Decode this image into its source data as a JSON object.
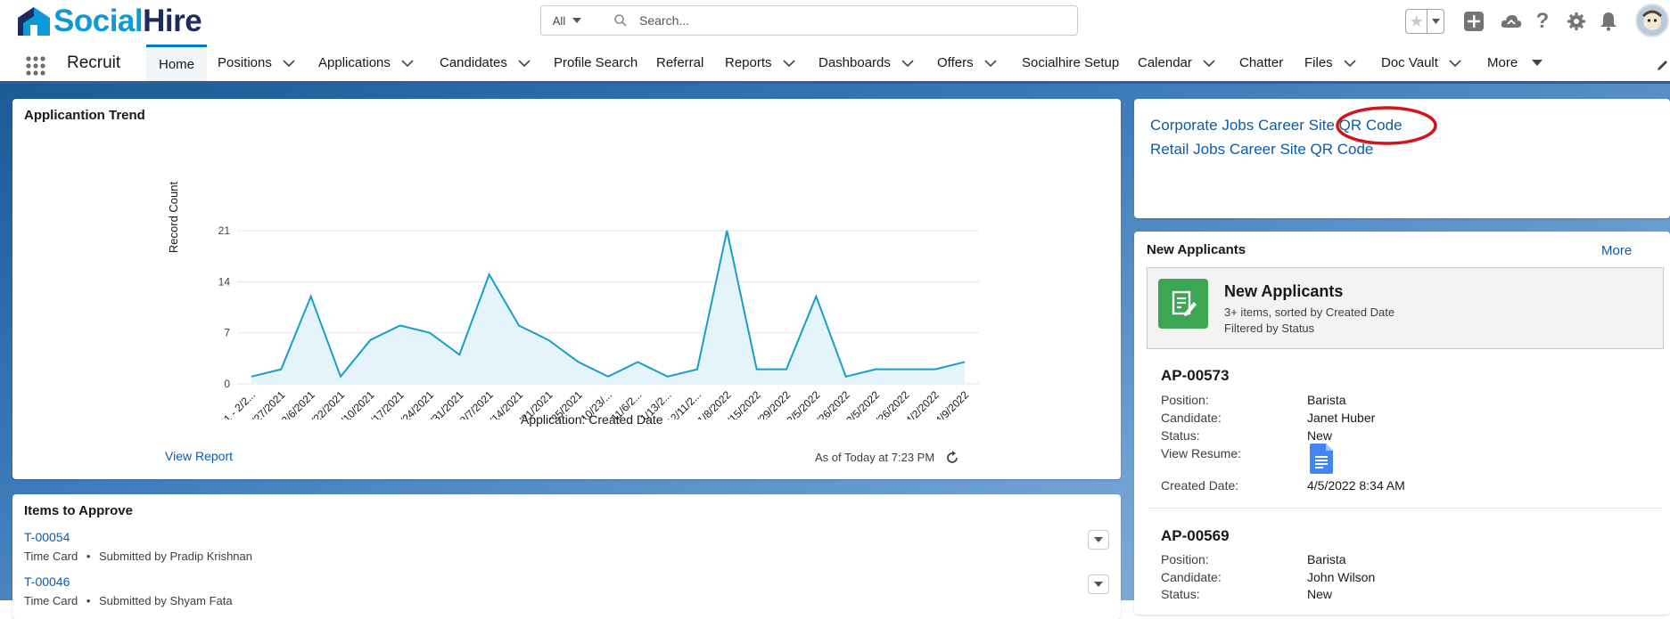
{
  "header": {
    "logo_text_1": "Social",
    "logo_text_2": "Hire",
    "search_scope": "All",
    "search_placeholder": "Search..."
  },
  "nav": {
    "app_name": "Recruit",
    "items": [
      {
        "label": "Home",
        "has_menu": false
      },
      {
        "label": "Positions",
        "has_menu": true
      },
      {
        "label": "Applications",
        "has_menu": true
      },
      {
        "label": "Candidates",
        "has_menu": true
      },
      {
        "label": "Profile Search",
        "has_menu": false
      },
      {
        "label": "Referral",
        "has_menu": false
      },
      {
        "label": "Reports",
        "has_menu": true
      },
      {
        "label": "Dashboards",
        "has_menu": true
      },
      {
        "label": "Offers",
        "has_menu": true
      },
      {
        "label": "Socialhire Setup",
        "has_menu": false
      },
      {
        "label": "Calendar",
        "has_menu": true
      },
      {
        "label": "Chatter",
        "has_menu": false
      },
      {
        "label": "Files",
        "has_menu": true
      },
      {
        "label": "Doc Vault",
        "has_menu": true
      },
      {
        "label": "More",
        "has_menu": true
      }
    ]
  },
  "trend_card": {
    "title": "Applicantion Trend",
    "view_report": "View Report",
    "as_of": "As of Today at 7:23 PM"
  },
  "chart_data": {
    "type": "area",
    "title": "",
    "xlabel": "Application: Created Date",
    "ylabel": "Record Count",
    "ylim": [
      0,
      21
    ],
    "yticks": [
      0,
      7,
      14,
      21
    ],
    "grid": true,
    "categories": [
      "2/14/2021 - 2/2...",
      "2/21/2021 - 2/27/2021",
      "2/28/2021 - 3/6/2021",
      "5/16/2021 - 5/22/2021",
      "7/4/2021 - 7/10/2021",
      "7/11/2021 - 7/17/2021",
      "7/18/2021 - 7/24/2021",
      "7/25/2021 - 7/31/2021",
      "8/1/2021 - 8/7/2021",
      "8/8/2021 - 8/14/2021",
      "8/15/2021 - 8/21/2021",
      "9/19/2021 - 9/25/2021",
      "10/17/2021 - 10/23/...",
      "10/31/2021 - 11/6/2...",
      "11/7/2021 - 11/13/2...",
      "12/5/2021 - 12/11/2...",
      "1/2/2022 - 1/8/2022",
      "1/9/2022 - 1/15/2022",
      "1/23/2022 - 1/29/2022",
      "1/30/2022 - 2/5/2022",
      "2/20/2022 - 2/26/2022",
      "2/27/2022 - 3/5/2022",
      "3/20/2022 - 3/26/2022",
      "3/27/2022 - 4/2/2022",
      "4/3/2022 - 4/9/2022"
    ],
    "values": [
      1,
      2,
      12,
      1,
      6,
      8,
      7,
      4,
      15,
      8,
      6,
      3,
      1,
      3,
      1,
      2,
      21,
      2,
      2,
      12,
      1,
      2,
      2,
      2,
      3
    ],
    "colors": {
      "line": "#199ec7",
      "fill": "#e4f4fa"
    }
  },
  "qr_card": {
    "corporate": "Corporate Jobs Career Site QR Code",
    "retail": "Retail Jobs Career Site QR Code"
  },
  "approvals": {
    "title": "Items to Approve",
    "items": [
      {
        "id": "T-00054",
        "type": "Time Card",
        "sep": "•",
        "submitted": "Submitted by Pradip Krishnan"
      },
      {
        "id": "T-00046",
        "type": "Time Card",
        "sep": "•",
        "submitted": "Submitted by Shyam Fata"
      }
    ]
  },
  "new_applicants": {
    "title": "New Applicants",
    "more": "More",
    "list_title": "New Applicants",
    "list_meta1": "3+ items, sorted by Created Date",
    "list_meta2": "Filtered by Status",
    "labels": {
      "position": "Position:",
      "candidate": "Candidate:",
      "status": "Status:",
      "resume": "View Resume:",
      "created": "Created Date:"
    },
    "records": [
      {
        "id": "AP-00573",
        "position": "Barista",
        "candidate": "Janet Huber",
        "status": "New",
        "created": "4/5/2022 8:34 AM"
      },
      {
        "id": "AP-00569",
        "position": "Barista",
        "candidate": "John Wilson",
        "status": "New"
      }
    ]
  }
}
